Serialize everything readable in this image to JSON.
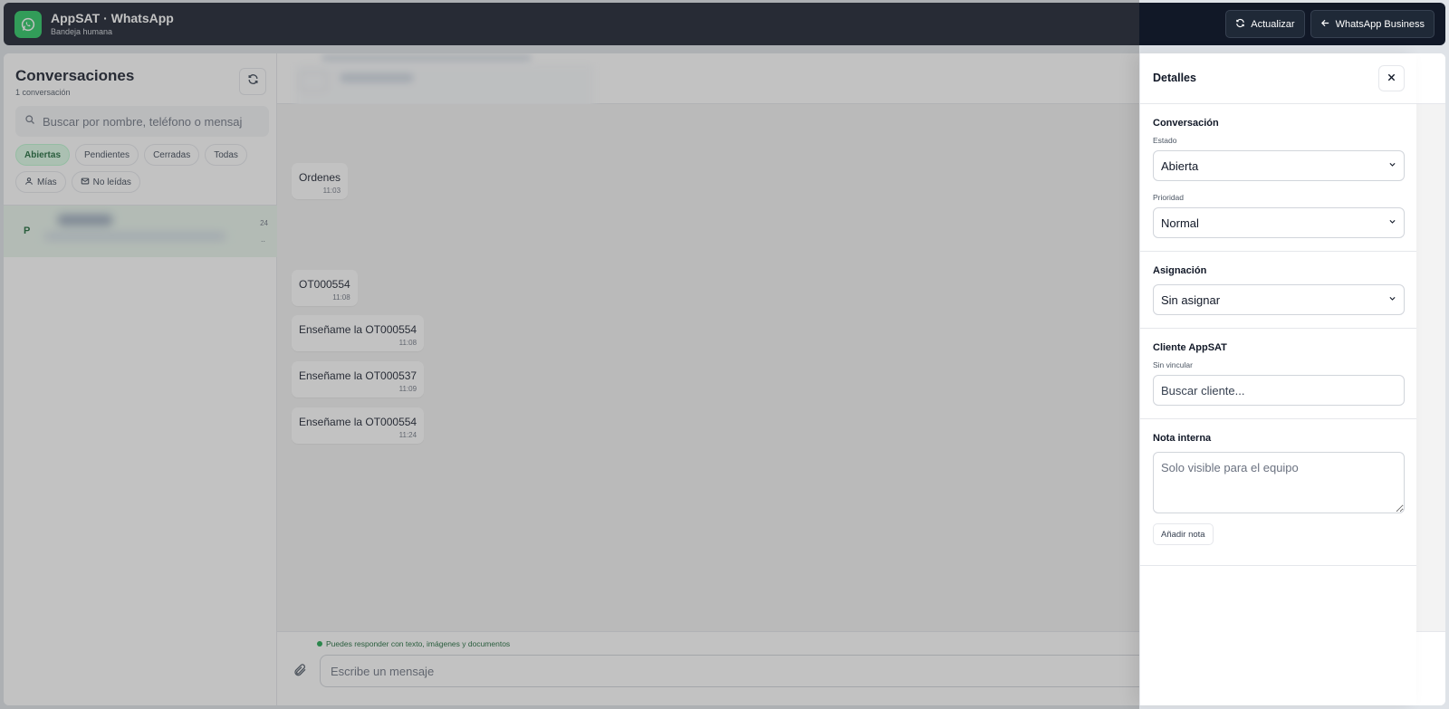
{
  "app": {
    "title": "AppSAT · WhatsApp",
    "subtitle": "Bandeja humana",
    "refresh_label": "Actualizar",
    "business_label": "WhatsApp Business",
    "brand_color": "#22c55e"
  },
  "sidebar": {
    "title": "Conversaciones",
    "count": "1 conversación",
    "search_placeholder": "Buscar por nombre, teléfono o mensaje",
    "filters": [
      {
        "label": "Abiertas",
        "active": true
      },
      {
        "label": "Pendientes",
        "active": false
      },
      {
        "label": "Cerradas",
        "active": false
      },
      {
        "label": "Todas",
        "active": false
      },
      {
        "label": "Mías",
        "active": false,
        "icon": "user-icon"
      },
      {
        "label": "No leídas",
        "active": false,
        "icon": "mail-icon"
      }
    ],
    "conversations": [
      {
        "avatar": "P",
        "time": "24",
        "preview": ".."
      }
    ]
  },
  "chat": {
    "messages": [
      {
        "text": "Ordenes",
        "time": "11:03"
      },
      {
        "text": "OT000554",
        "time": "11:08"
      },
      {
        "text": "Enseñame la OT000554",
        "time": "11:08"
      },
      {
        "text": "Enseñame la OT000537",
        "time": "11:09"
      },
      {
        "text": "Enseñame la OT000554",
        "time": "11:24"
      }
    ],
    "hint": "Puedes responder con texto, imágenes y documentos",
    "input_placeholder": "Escribe un mensaje"
  },
  "details": {
    "title": "Detalles",
    "conversation": {
      "title": "Conversación",
      "status_label": "Estado",
      "status_value": "Abierta",
      "priority_label": "Prioridad",
      "priority_value": "Normal"
    },
    "assignment": {
      "title": "Asignación",
      "value": "Sin asignar"
    },
    "client": {
      "title": "Cliente AppSAT",
      "status": "Sin vincular",
      "search_placeholder": "Buscar cliente..."
    },
    "note": {
      "title": "Nota interna",
      "placeholder": "Solo visible para el equipo",
      "button": "Añadir nota"
    }
  }
}
